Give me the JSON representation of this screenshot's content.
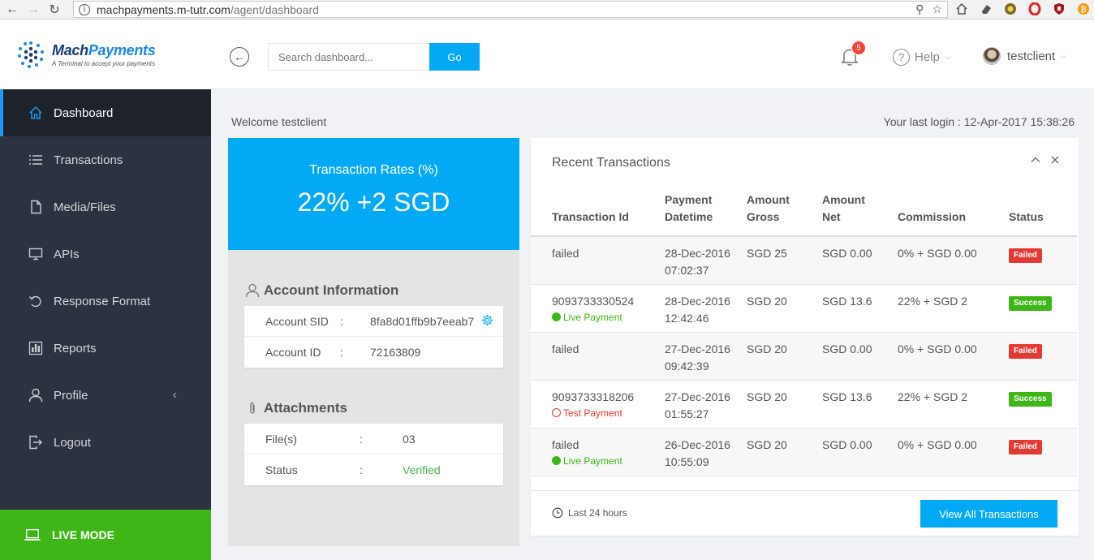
{
  "browser": {
    "url_host": "machpayments.m-tutr.com",
    "url_path": "/agent/dashboard"
  },
  "brand": {
    "name_part1": "Mach",
    "name_part2": "Payments",
    "tagline": "A Terminal to accept your payments"
  },
  "sidebar": {
    "items": [
      {
        "label": "Dashboard",
        "icon": "home-icon"
      },
      {
        "label": "Transactions",
        "icon": "list-icon"
      },
      {
        "label": "Media/Files",
        "icon": "file-icon"
      },
      {
        "label": "APIs",
        "icon": "monitor-icon"
      },
      {
        "label": "Response Format",
        "icon": "undo-icon"
      },
      {
        "label": "Reports",
        "icon": "bar-chart-icon"
      },
      {
        "label": "Profile",
        "icon": "user-icon"
      },
      {
        "label": "Logout",
        "icon": "logout-icon"
      }
    ],
    "mode_label": "LIVE MODE"
  },
  "header": {
    "search_placeholder": "Search dashboard...",
    "go_label": "Go",
    "notification_count": "5",
    "help_label": "Help",
    "username": "testclient"
  },
  "welcome": {
    "text": "Welcome testclient",
    "last_login": "Your last login : 12-Apr-2017 15:38:26"
  },
  "rates": {
    "title": "Transaction Rates (%)",
    "value": "22% +2 SGD"
  },
  "account": {
    "title": "Account Information",
    "rows": [
      {
        "key": "Account SID",
        "sep": ":",
        "value": "8fa8d01ffb9b7eeab7"
      },
      {
        "key": "Account ID",
        "sep": ":",
        "value": "72163809"
      }
    ]
  },
  "attachments": {
    "title": "Attachments",
    "rows": [
      {
        "key": "File(s)",
        "sep": ":",
        "value": "03"
      },
      {
        "key": "Status",
        "sep": ":",
        "value": "Verified"
      }
    ]
  },
  "recent": {
    "title": "Recent Transactions",
    "columns": [
      "Transaction Id",
      "Payment Datetime",
      "Amount Gross",
      "Amount Net",
      "Commission",
      "Status"
    ],
    "column_lines": [
      [
        "",
        "Transaction Id"
      ],
      [
        "Payment",
        "Datetime"
      ],
      [
        "Amount",
        "Gross"
      ],
      [
        "Amount",
        "Net"
      ],
      [
        "",
        "Commission"
      ],
      [
        "",
        "Status"
      ]
    ],
    "rows": [
      {
        "id": "failed",
        "mode": "",
        "date": "28-Dec-2016",
        "time": "07:02:37",
        "gross": "SGD 25",
        "net": "SGD 0.00",
        "commission": "0% + SGD 0.00",
        "status": "Failed"
      },
      {
        "id": "9093733330524",
        "mode": "Live Payment",
        "date": "28-Dec-2016",
        "time": "12:42:46",
        "gross": "SGD 20",
        "net": "SGD 13.6",
        "commission": "22% + SGD 2",
        "status": "Success"
      },
      {
        "id": "failed",
        "mode": "",
        "date": "27-Dec-2016",
        "time": "09:42:39",
        "gross": "SGD 20",
        "net": "SGD 0.00",
        "commission": "0% + SGD 0.00",
        "status": "Failed"
      },
      {
        "id": "9093733318206",
        "mode": "Test Payment",
        "date": "27-Dec-2016",
        "time": "01:55:27",
        "gross": "SGD 20",
        "net": "SGD 13.6",
        "commission": "22% + SGD 2",
        "status": "Success"
      },
      {
        "id": "failed",
        "mode": "Live Payment",
        "date": "26-Dec-2016",
        "time": "10:55:09",
        "gross": "SGD 20",
        "net": "SGD 0.00",
        "commission": "0% + SGD 0.00",
        "status": "Failed"
      }
    ],
    "footer_label": "Last 24 hours",
    "view_all_label": "View All Transactions"
  },
  "colors": {
    "accent": "#03a9f4",
    "sidebar": "#2c323f",
    "live": "#3fb618",
    "failed": "#e53935"
  }
}
